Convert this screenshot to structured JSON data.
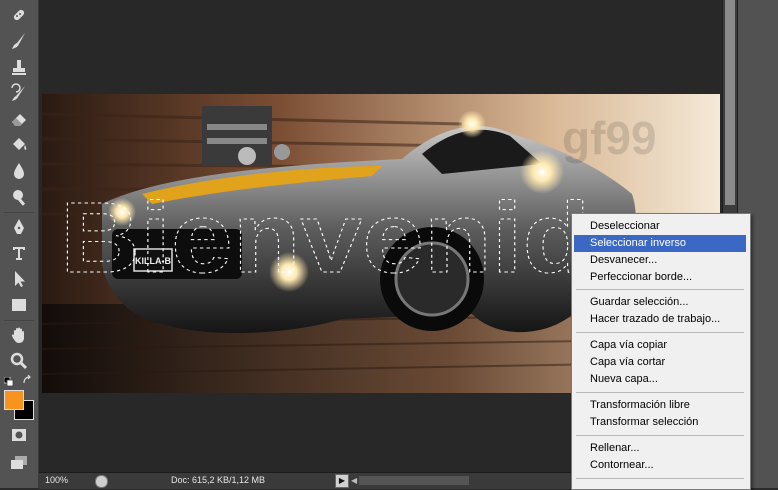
{
  "toolbar": {
    "tools": [
      {
        "icon": "spot-healing-brush-icon"
      },
      {
        "icon": "brush-icon"
      },
      {
        "icon": "clone-stamp-icon"
      },
      {
        "icon": "history-brush-icon"
      },
      {
        "icon": "eraser-icon"
      },
      {
        "icon": "paint-bucket-icon"
      },
      {
        "icon": "blur-icon"
      },
      {
        "icon": "dodge-icon"
      },
      {
        "icon": "pen-icon"
      },
      {
        "icon": "type-icon"
      },
      {
        "icon": "path-selection-icon"
      },
      {
        "icon": "rectangle-icon"
      },
      {
        "icon": "hand-icon"
      },
      {
        "icon": "zoom-icon"
      }
    ],
    "foreground_color": "#f7941d",
    "background_color": "#000000"
  },
  "canvas": {
    "watermark_text": "gf99",
    "selection_text": "Bienvenidos",
    "plate_text": "KILLA-B"
  },
  "status": {
    "zoom": "100%",
    "doc_info": "Doc: 615,2 KB/1,12 MB"
  },
  "context_menu": {
    "items": [
      {
        "label": "Deseleccionar",
        "highlighted": false
      },
      {
        "label": "Seleccionar inverso",
        "highlighted": true
      },
      {
        "label": "Desvanecer...",
        "highlighted": false
      },
      {
        "label": "Perfeccionar borde...",
        "highlighted": false
      },
      {
        "label": "Guardar selección...",
        "highlighted": false
      },
      {
        "label": "Hacer trazado de trabajo...",
        "highlighted": false
      },
      {
        "label": "Capa vía copiar",
        "highlighted": false
      },
      {
        "label": "Capa vía cortar",
        "highlighted": false
      },
      {
        "label": "Nueva capa...",
        "highlighted": false
      },
      {
        "label": "Transformación libre",
        "highlighted": false
      },
      {
        "label": "Transformar selección",
        "highlighted": false
      },
      {
        "label": "Rellenar...",
        "highlighted": false
      },
      {
        "label": "Contornear...",
        "highlighted": false
      }
    ]
  },
  "colors": {
    "menu_highlight": "#3b68c4",
    "workspace": "#282828",
    "toolbar": "#535353"
  }
}
